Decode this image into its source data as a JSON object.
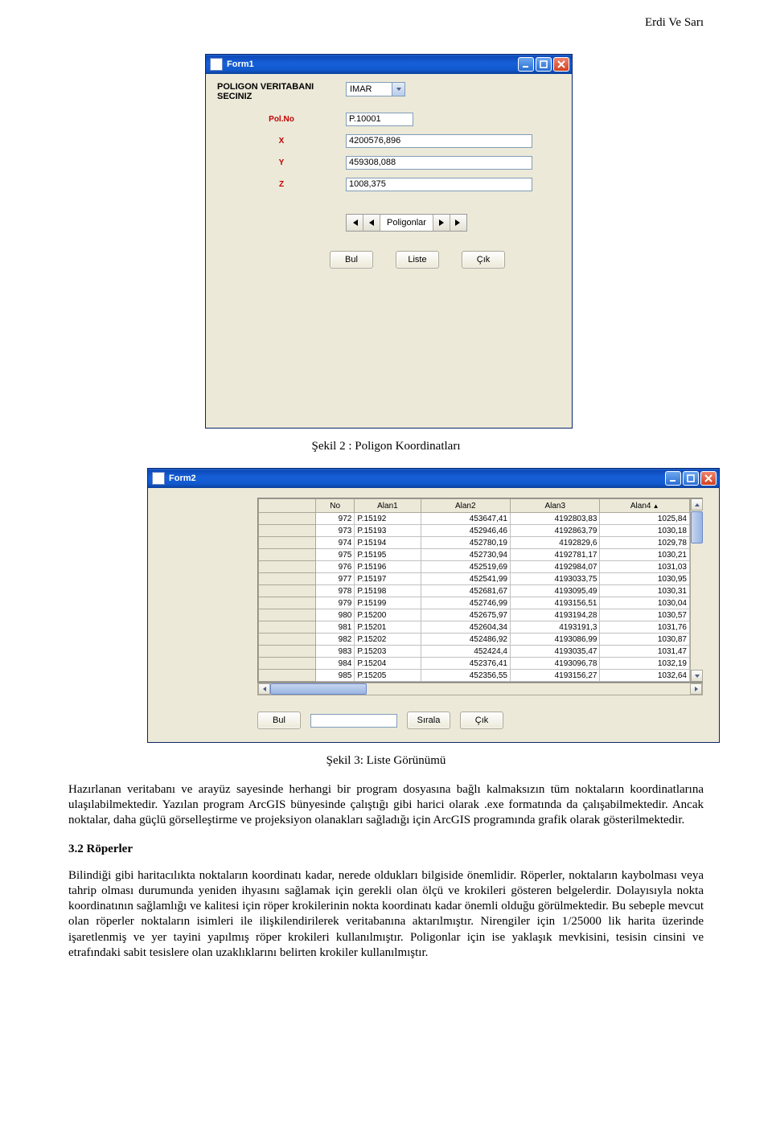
{
  "header": {
    "text": "Erdi Ve Sarı"
  },
  "form1": {
    "title": "Form1",
    "mainLabel": "POLIGON VERITABANI\nSECINIZ",
    "combo": "IMAR",
    "fields": {
      "polno": {
        "label": "Pol.No",
        "value": "P.10001"
      },
      "x": {
        "label": "X",
        "value": "4200576,896"
      },
      "y": {
        "label": "Y",
        "value": "459308,088"
      },
      "z": {
        "label": "Z",
        "value": "1008,375"
      }
    },
    "nav": {
      "label": "Poligonlar"
    },
    "buttons": {
      "bul": "Bul",
      "liste": "Liste",
      "cik": "Çık"
    }
  },
  "caption1": "Şekil 2 : Poligon Koordinatları",
  "form2": {
    "title": "Form2",
    "headers": [
      "",
      "No",
      "Alan1",
      "Alan2",
      "Alan3",
      "Alan4"
    ],
    "rows": [
      [
        "972",
        "P.15192",
        "453647,41",
        "4192803,83",
        "1025,84"
      ],
      [
        "973",
        "P.15193",
        "452946,46",
        "4192863,79",
        "1030,18"
      ],
      [
        "974",
        "P.15194",
        "452780,19",
        "4192829,6",
        "1029,78"
      ],
      [
        "975",
        "P.15195",
        "452730,94",
        "4192781,17",
        "1030,21"
      ],
      [
        "976",
        "P.15196",
        "452519,69",
        "4192984,07",
        "1031,03"
      ],
      [
        "977",
        "P.15197",
        "452541,99",
        "4193033,75",
        "1030,95"
      ],
      [
        "978",
        "P.15198",
        "452681,67",
        "4193095,49",
        "1030,31"
      ],
      [
        "979",
        "P.15199",
        "452746,99",
        "4193156,51",
        "1030,04"
      ],
      [
        "980",
        "P.15200",
        "452675,97",
        "4193194,28",
        "1030,57"
      ],
      [
        "981",
        "P.15201",
        "452604,34",
        "4193191,3",
        "1031,76"
      ],
      [
        "982",
        "P.15202",
        "452486,92",
        "4193086,99",
        "1030,87"
      ],
      [
        "983",
        "P.15203",
        "452424,4",
        "4193035,47",
        "1031,47"
      ],
      [
        "984",
        "P.15204",
        "452376,41",
        "4193096,78",
        "1032,19"
      ],
      [
        "985",
        "P.15205",
        "452356,55",
        "4193156,27",
        "1032,64"
      ]
    ],
    "buttons": {
      "bul": "Bul",
      "sirala": "Sırala",
      "cik": "Çık"
    }
  },
  "caption2": "Şekil 3: Liste Görünümü",
  "body": {
    "para1": "Hazırlanan veritabanı ve arayüz sayesinde herhangi bir program dosyasına bağlı kalmaksızın tüm noktaların koordinatlarına ulaşılabilmektedir. Yazılan program ArcGIS bünyesinde çalıştığı gibi harici olarak .exe formatında da çalışabilmektedir. Ancak noktalar, daha güçlü görselleştirme ve projeksiyon olanakları sağladığı için ArcGIS programında grafik olarak gösterilmektedir.",
    "section": "3.2 Röperler",
    "para2": "Bilindiği gibi haritacılıkta noktaların koordinatı kadar, nerede oldukları bilgiside önemlidir. Röperler, noktaların kaybolması veya tahrip olması durumunda yeniden ihyasını sağlamak için gerekli olan ölçü ve krokileri gösteren belgelerdir. Dolayısıyla nokta koordinatının sağlamlığı ve kalitesi için röper krokilerinin nokta koordinatı kadar önemli olduğu görülmektedir. Bu sebeple mevcut olan röperler noktaların isimleri ile ilişkilendirilerek veritabanına aktarılmıştır. Nirengiler için 1/25000 lik harita üzerinde işaretlenmiş ve yer tayini yapılmış röper krokileri kullanılmıştır. Poligonlar için ise yaklaşık mevkisini, tesisin cinsini ve etrafındaki sabit tesislere olan uzaklıklarını belirten krokiler kullanılmıştır."
  }
}
